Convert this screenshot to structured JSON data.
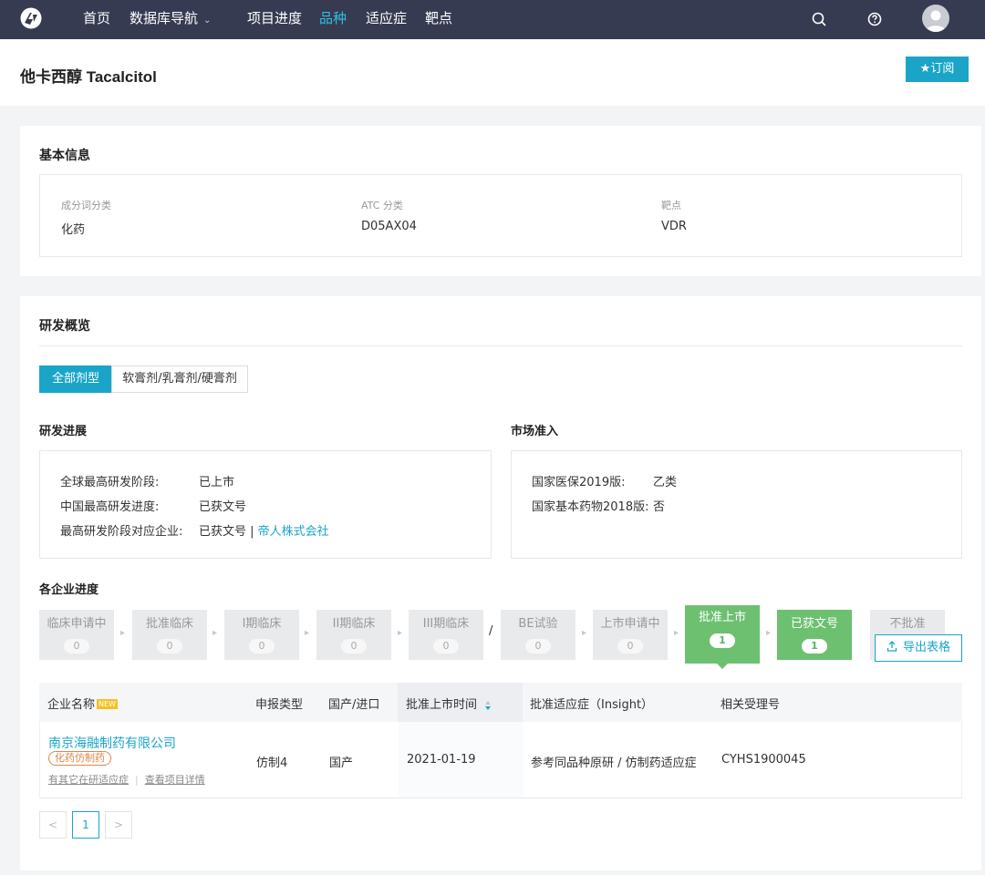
{
  "nav": {
    "home": "首页",
    "db_nav": "数据库导航",
    "progress": "项目进度",
    "variety": "品种",
    "indication": "适应症",
    "target": "靶点"
  },
  "title": {
    "text": "他卡西醇 Tacalcitol",
    "subscribe": "★订阅"
  },
  "basic": {
    "heading": "基本信息",
    "fields": [
      {
        "label": "成分词分类",
        "value": "化药"
      },
      {
        "label": "ATC 分类",
        "value": "D05AX04"
      },
      {
        "label": "靶点",
        "value": "VDR"
      }
    ]
  },
  "dev": {
    "heading": "研发概览",
    "tabs": [
      "全部剂型",
      "软膏剂/乳膏剂/硬膏剂"
    ],
    "progress_heading": "研发进展",
    "market_heading": "市场准入",
    "progress": {
      "global_label": "全球最高研发阶段:",
      "global_value": "已上市",
      "china_label": "中国最高研发进度:",
      "china_value": "已获文号",
      "company_label": "最高研发阶段对应企业:",
      "company_prefix": "已获文号 | ",
      "company_link": "帝人株式会社"
    },
    "market": {
      "nrdl_label": "国家医保2019版:",
      "nrdl_value": "乙类",
      "edl_label": "国家基本药物2018版:",
      "edl_value": "否"
    },
    "company_heading": "各企业进度",
    "stages": [
      {
        "label": "临床申请中",
        "count": "0"
      },
      {
        "label": "批准临床",
        "count": "0"
      },
      {
        "label": "I期临床",
        "count": "0"
      },
      {
        "label": "II期临床",
        "count": "0"
      },
      {
        "label": "III期临床",
        "count": "0"
      },
      {
        "label": "BE试验",
        "count": "0"
      },
      {
        "label": "上市申请中",
        "count": "0"
      },
      {
        "label": "批准上市",
        "count": "1"
      },
      {
        "label": "已获文号",
        "count": "1"
      },
      {
        "label": "不批准",
        "count": ""
      }
    ],
    "stage_slash": "/",
    "export": "导出表格"
  },
  "table": {
    "headers": {
      "company": "企业名称",
      "new_badge": "NEW",
      "apply_type": "申报类型",
      "origin": "国产/进口",
      "approval_date": "批准上市时间",
      "indication": "批准适应症（Insight）",
      "accept_no": "相关受理号"
    },
    "rows": [
      {
        "company": "南京海融制药有限公司",
        "tag": "化药仿制药",
        "link1": "有其它在研适应症",
        "link2": "查看项目详情",
        "apply_type": "仿制4",
        "origin": "国产",
        "approval_date": "2021-01-19",
        "indication": "参考同品种原研 / 仿制药适应症",
        "accept_no": "CYHS1900045"
      }
    ]
  },
  "pagination": {
    "prev": "<",
    "current": "1",
    "next": ">"
  },
  "colors": {
    "accent": "#1aa5c8",
    "nav_bg": "#363b52",
    "stage_done": "#6cc070",
    "tag": "#e0874a"
  }
}
